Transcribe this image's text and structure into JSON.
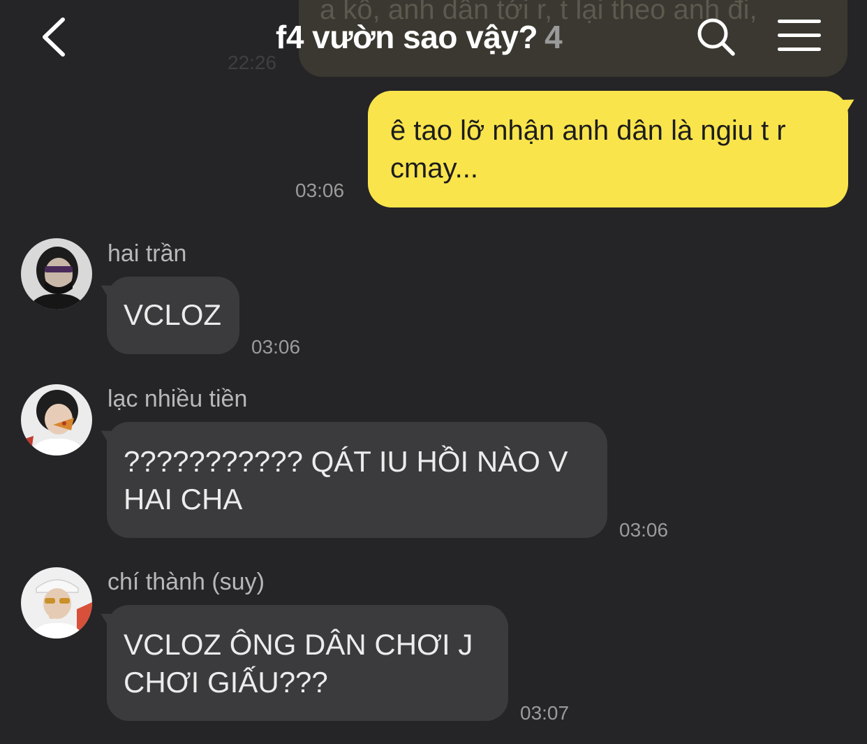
{
  "previous_message": {
    "text": "a kô, anh dân tới r, t lại theo anh đi,",
    "time": "22:26"
  },
  "header": {
    "title": "f4 vườn sao vậy?",
    "member_count": "4"
  },
  "messages": [
    {
      "direction": "outgoing",
      "text": "ê tao lỡ nhận anh dân là ngiu t r cmay...",
      "time": "03:06"
    },
    {
      "direction": "incoming",
      "sender": "hai trần",
      "text": "VCLOZ",
      "time": "03:06"
    },
    {
      "direction": "incoming",
      "sender": "lạc nhiều tiền",
      "text": "??????????? QÁT IU HỒI NÀO V HAI CHA",
      "time": "03:06"
    },
    {
      "direction": "incoming",
      "sender": "chí thành (suy)",
      "text": "VCLOZ ÔNG DÂN CHƠI J CHƠI GIẤU???",
      "time": "03:07"
    }
  ],
  "icons": {
    "back": "chevron-left-icon",
    "search": "search-icon",
    "menu": "hamburger-menu-icon"
  },
  "colors": {
    "background": "#252527",
    "outgoing_bubble": "#f9e44c",
    "incoming_bubble": "#3b3b3d"
  }
}
